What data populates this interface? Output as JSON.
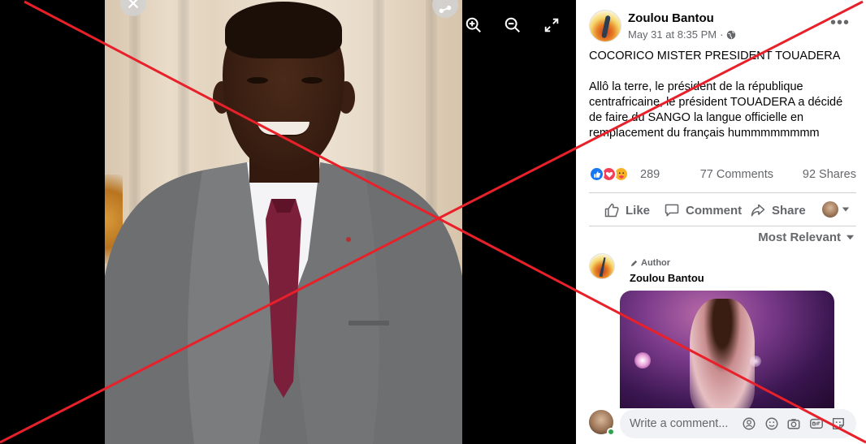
{
  "post": {
    "author": "Zoulou Bantou",
    "timestamp": "May 31 at 8:35 PM",
    "meta_separator": "·",
    "more_options": "•••",
    "paragraph1": "COCORICO MISTER PRESIDENT TOUADERA",
    "paragraph2": "Allô la terre, le président de la république centrafricaine, le président TOUADERA a décidé de faire du SANGO la langue officielle en remplacement du français hummmmmmmm"
  },
  "stats": {
    "reactions": "289",
    "comments": "77 Comments",
    "shares": "92 Shares"
  },
  "actions": {
    "like": "Like",
    "comment": "Comment",
    "share": "Share"
  },
  "sort_label": "Most Relevant",
  "top_comment": {
    "badge": "Author",
    "author": "Zoulou Bantou"
  },
  "composer": {
    "placeholder": "Write a comment..."
  },
  "colors": {
    "cross": "#e8202a",
    "fb_blue": "#1877f2",
    "secondary_text": "#65676b"
  },
  "icons": [
    "close-icon",
    "share-icon",
    "zoom-in-icon",
    "zoom-out-icon",
    "fullscreen-icon",
    "globe-icon",
    "like-icon",
    "comment-icon",
    "share-arrow-icon",
    "caret-down-icon",
    "pencil-icon",
    "emoji-icon",
    "camera-icon",
    "gif-icon",
    "sticker-icon"
  ]
}
